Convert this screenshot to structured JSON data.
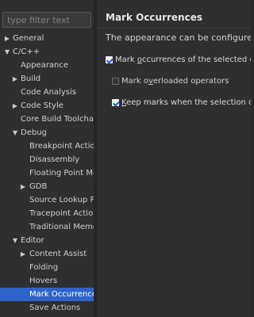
{
  "filter": {
    "placeholder": "type filter text"
  },
  "tree": [
    {
      "label": "General",
      "expanded": false,
      "has_children": true,
      "selected": false
    },
    {
      "label": "C/C++",
      "expanded": true,
      "has_children": true,
      "selected": false
    },
    {
      "label": "Appearance",
      "has_children": false,
      "selected": false
    },
    {
      "label": "Build",
      "expanded": false,
      "has_children": true,
      "selected": false
    },
    {
      "label": "Code Analysis",
      "has_children": false,
      "selected": false
    },
    {
      "label": "Code Style",
      "expanded": false,
      "has_children": true,
      "selected": false
    },
    {
      "label": "Core Build Toolchains",
      "has_children": false,
      "selected": false
    },
    {
      "label": "Debug",
      "expanded": true,
      "has_children": true,
      "selected": false
    },
    {
      "label": "Breakpoint Actions",
      "has_children": false,
      "selected": false
    },
    {
      "label": "Disassembly",
      "has_children": false,
      "selected": false
    },
    {
      "label": "Floating Point Mem",
      "has_children": false,
      "selected": false
    },
    {
      "label": "GDB",
      "expanded": false,
      "has_children": true,
      "selected": false
    },
    {
      "label": "Source Lookup Path",
      "has_children": false,
      "selected": false
    },
    {
      "label": "Tracepoint Actions",
      "has_children": false,
      "selected": false
    },
    {
      "label": "Traditional Memory",
      "has_children": false,
      "selected": false
    },
    {
      "label": "Editor",
      "expanded": true,
      "has_children": true,
      "selected": false
    },
    {
      "label": "Content Assist",
      "expanded": false,
      "has_children": true,
      "selected": false
    },
    {
      "label": "Folding",
      "has_children": false,
      "selected": false
    },
    {
      "label": "Hovers",
      "has_children": false,
      "selected": false
    },
    {
      "label": "Mark Occurrences",
      "has_children": false,
      "selected": true
    },
    {
      "label": "Save Actions",
      "has_children": false,
      "selected": false
    }
  ],
  "page": {
    "title": "Mark Occurrences",
    "description": "The appearance can be configured on th"
  },
  "options": {
    "mark_occurrences": {
      "before": "Mark ",
      "mnemonic": "o",
      "after": "ccurrences of the selected eleme",
      "checked": true
    },
    "mark_overloaded": {
      "before": "Mark o",
      "mnemonic": "v",
      "after": "erloaded operators",
      "checked": false
    },
    "keep_marks": {
      "before": "",
      "mnemonic": "K",
      "after": "eep marks when the selection change",
      "checked": true
    }
  },
  "colors": {
    "selection": "#2f65ca",
    "background": "#2f2f2f"
  }
}
